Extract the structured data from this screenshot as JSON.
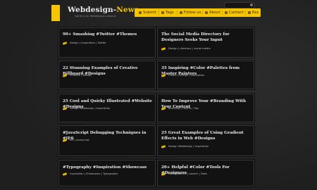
{
  "header": {
    "logo_main": "Webdesign-",
    "logo_accent": "News",
    "tagline": "Gallery by Webdesign-news.it",
    "nav": [
      {
        "label": "Submit",
        "icon": "submit-icon"
      },
      {
        "label": "Tags",
        "icon": "tag-icon"
      },
      {
        "label": "Follow us",
        "icon": "twitter-icon"
      },
      {
        "label": "About",
        "icon": "heart-icon"
      },
      {
        "label": "Contact",
        "icon": "contact-icon"
      },
      {
        "label": "Rss",
        "icon": "rss-icon"
      }
    ]
  },
  "posts": [
    {
      "title": "90+ Smashing #Twitter #Themes",
      "tags": "Design | Inspiration | Twitter"
    },
    {
      "title": "The Social Media Directory for Designers Seeks Your Input",
      "tags": "Design | directory | social media"
    },
    {
      "title": "22 Stunning Examples of Creative Billboard #Designs",
      "tags": "creative | Design"
    },
    {
      "title": "35 Inspiring #Color #Palettes from Master Painters",
      "tags": "Colour | Design | Inspiration"
    },
    {
      "title": "25 Cool and Quirky Illustrated #Website #Designs",
      "tags": "Design Webdesign | Inspiration"
    },
    {
      "title": "How To Improve Your #Branding With Your Content",
      "tags": "branding | HowTo | Tips"
    },
    {
      "title": "#JavaScript Debugging Techniques in #IE6",
      "tags": "IE6 | javascript"
    },
    {
      "title": "25 Great Examples of Using Gradient Effects in Web #Designs",
      "tags": "Design Webdesign | Inspiration"
    },
    {
      "title": "#Typography #Inspiration #Showcase",
      "tags": "Inspiration | Showcases | Typography"
    },
    {
      "title": "20+ Helpful #Color #Tools For #Designers",
      "tags": "color | palette | swatch | Tools"
    }
  ]
}
